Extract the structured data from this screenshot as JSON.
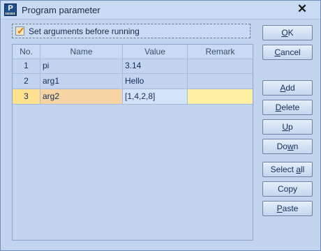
{
  "window": {
    "title": "Program parameter"
  },
  "options": {
    "set_args_label": "Set arguments before running",
    "set_args_checked": true
  },
  "table": {
    "columns": [
      "No.",
      "Name",
      "Value",
      "Remark"
    ],
    "rows": [
      {
        "no": "1",
        "name": "pi",
        "value": "3.14",
        "remark": ""
      },
      {
        "no": "2",
        "name": "arg1",
        "value": "Hello",
        "remark": ""
      },
      {
        "no": "3",
        "name": "arg2",
        "value": "[1,4,2,8]",
        "remark": ""
      }
    ],
    "selected_row": 3
  },
  "buttons": {
    "ok": {
      "pre": "",
      "key": "O",
      "post": "K"
    },
    "cancel": {
      "pre": "",
      "key": "C",
      "post": "ancel"
    },
    "add": {
      "pre": "",
      "key": "A",
      "post": "dd"
    },
    "delete": {
      "pre": "",
      "key": "D",
      "post": "elete"
    },
    "up": {
      "pre": "",
      "key": "U",
      "post": "p"
    },
    "down": {
      "pre": "Do",
      "key": "w",
      "post": "n"
    },
    "select_all": {
      "pre": "Select ",
      "key": "a",
      "post": "ll"
    },
    "copy": {
      "pre": "Copy",
      "key": "",
      "post": ""
    },
    "paste": {
      "pre": "",
      "key": "P",
      "post": "aste"
    }
  },
  "icons": {
    "app": "program-app-icon",
    "close": "close-icon",
    "check": "checkmark-icon"
  }
}
